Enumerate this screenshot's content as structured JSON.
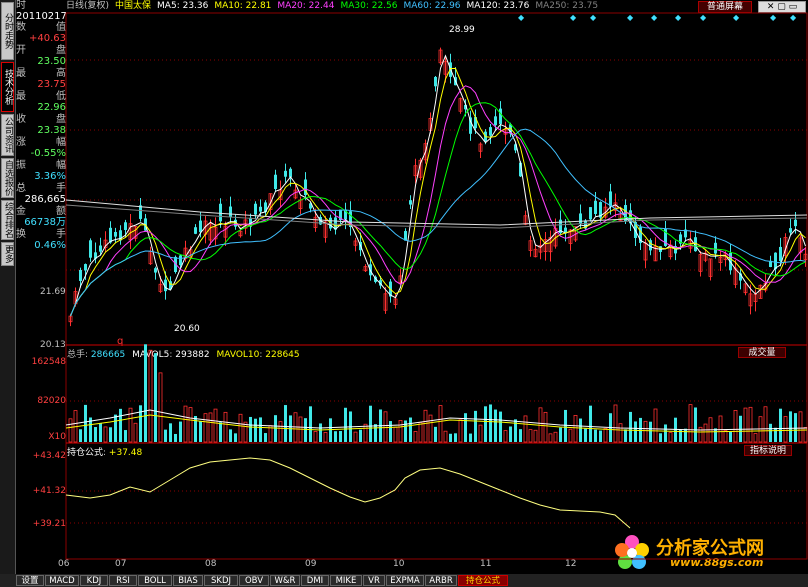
{
  "left_nav": [
    {
      "label": "分时走势",
      "active": false
    },
    {
      "label": "技术分析",
      "active": true
    },
    {
      "label": "公司资讯",
      "active": false
    },
    {
      "label": "自选报价",
      "active": false
    },
    {
      "label": "综合排名",
      "active": false
    },
    {
      "label": "更多",
      "active": false
    }
  ],
  "info": {
    "time_label": "时",
    "date": "20110217",
    "rows": [
      {
        "label": "数",
        "label2": "值",
        "value": "+40.63",
        "color": "#ff4040"
      },
      {
        "label": "开",
        "label2": "盘",
        "value": "23.50",
        "color": "#60ff60"
      },
      {
        "label": "最",
        "label2": "高",
        "value": "23.75",
        "color": "#ff4040"
      },
      {
        "label": "最",
        "label2": "低",
        "value": "22.96",
        "color": "#60ff60"
      },
      {
        "label": "收",
        "label2": "盘",
        "value": "23.38",
        "color": "#60ff60"
      },
      {
        "label": "涨",
        "label2": "幅",
        "value": "-0.55%",
        "color": "#60ff60"
      },
      {
        "label": "振",
        "label2": "幅",
        "value": "3.36%",
        "color": "#40e0ff"
      },
      {
        "label": "总",
        "label2": "手",
        "value": "286,665",
        "color": "#ffffff"
      },
      {
        "label": "金",
        "label2": "额",
        "value": "66738万",
        "color": "#40e0ff"
      },
      {
        "label": "换",
        "label2": "手",
        "value": "0.46%",
        "color": "#40e0ff"
      }
    ]
  },
  "header": {
    "period": "日线(复权)",
    "stock": "中国太保",
    "ma": [
      {
        "name": "MA5",
        "value": "23.36",
        "color": "#ffffff"
      },
      {
        "name": "MA10",
        "value": "22.81",
        "color": "#ffff00"
      },
      {
        "name": "MA20",
        "value": "22.44",
        "color": "#ff40ff"
      },
      {
        "name": "MA30",
        "value": "22.56",
        "color": "#00ff00"
      },
      {
        "name": "MA60",
        "value": "22.96",
        "color": "#40c0ff"
      },
      {
        "name": "MA120",
        "value": "23.76",
        "color": "#ffffff"
      },
      {
        "name": "MA250",
        "value": "23.75",
        "color": "#808080"
      }
    ],
    "view_button": "普通屏幕"
  },
  "price_axis": [
    "21.69",
    "20.13"
  ],
  "price_marks": {
    "high": "28.99",
    "low": "20.60",
    "q_mark": "q"
  },
  "volume": {
    "header_label": "总手",
    "header_value": "286665",
    "mavol5_label": "MAVOL5",
    "mavol5": "293882",
    "mavol10_label": "MAVOL10",
    "mavol10": "228645",
    "axis": [
      "162548",
      "82020"
    ],
    "unit": "X10",
    "button": "成交量"
  },
  "indicator": {
    "name": "持仓公式",
    "value": "+37.48",
    "axis": [
      "+43.42",
      "+41.32",
      "+39.21"
    ],
    "button": "指标说明"
  },
  "x_labels": [
    "06",
    "07",
    "08",
    "09",
    "10",
    "11",
    "12"
  ],
  "bottom_tabs": [
    {
      "label": "设置",
      "active": false
    },
    {
      "label": "MACD",
      "active": false
    },
    {
      "label": "KDJ",
      "active": false
    },
    {
      "label": "RSI",
      "active": false
    },
    {
      "label": "BOLL",
      "active": false
    },
    {
      "label": "BIAS",
      "active": false
    },
    {
      "label": "SKDJ",
      "active": false
    },
    {
      "label": "OBV",
      "active": false
    },
    {
      "label": "W&R",
      "active": false
    },
    {
      "label": "DMI",
      "active": false
    },
    {
      "label": "MIKE",
      "active": false
    },
    {
      "label": "VR",
      "active": false
    },
    {
      "label": "EXPMA",
      "active": false
    },
    {
      "label": "ARBR",
      "active": false
    },
    {
      "label": "持仓公式",
      "active": true
    }
  ],
  "watermark": {
    "brand": "分析家公式网",
    "url": "www.88gs.com"
  },
  "colors": {
    "up": "#ff3030",
    "down": "#40e8e8",
    "grid": "#8b0000",
    "ma5": "#ffffff",
    "ma10": "#ffff00",
    "ma20": "#ff40ff",
    "ma30": "#00ff00",
    "ma60": "#40c0ff"
  }
}
